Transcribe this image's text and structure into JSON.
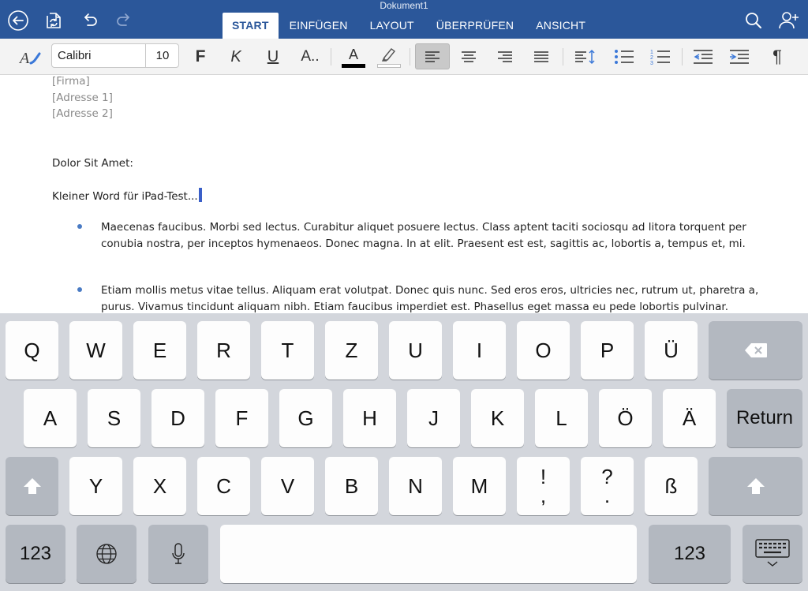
{
  "title_bar": {
    "doc_title": "Dokument1",
    "tabs": [
      {
        "label": "START",
        "active": true
      },
      {
        "label": "EINFÜGEN",
        "active": false
      },
      {
        "label": "LAYOUT",
        "active": false
      },
      {
        "label": "ÜBERPRÜFEN",
        "active": false
      },
      {
        "label": "ANSICHT",
        "active": false
      }
    ],
    "icons": [
      "back-icon",
      "sync-icon",
      "undo-icon",
      "redo-icon",
      "search-icon",
      "add-person-icon"
    ]
  },
  "ribbon": {
    "font_name": "Calibri",
    "font_size": "10",
    "bold_label": "F",
    "italic_label": "K",
    "underline_label": "U",
    "more_label": "A..",
    "font_color_label": "A",
    "paragraph_mark": "¶",
    "font_color": "#000000",
    "highlight_color": "#ffffff"
  },
  "document": {
    "address_lines": [
      "[Firma]",
      "[Adresse 1]",
      "[Adresse 2]"
    ],
    "salutation": "Dolor Sit Amet:",
    "current_line": "Kleiner Word für iPad-Test...",
    "bullets": [
      "Maecenas faucibus. Morbi sed lectus. Curabitur aliquet posuere lectus. Class aptent taciti sociosqu ad litora torquent per conubia nostra, per inceptos hymenaeos. Donec magna. In at elit. Praesent est est, sagittis ac, lobortis a, tempus et, mi.",
      "Etiam mollis metus vitae tellus. Aliquam erat volutpat. Donec quis nunc. Sed eros eros, ultricies nec, rutrum ut, pharetra a, purus. Vivamus tincidunt aliquam nibh. Etiam faucibus imperdiet est. Phasellus eget massa eu pede lobortis pulvinar."
    ]
  },
  "keyboard": {
    "row1": [
      "Q",
      "W",
      "E",
      "R",
      "T",
      "Z",
      "U",
      "I",
      "O",
      "P",
      "Ü"
    ],
    "row2": [
      "A",
      "S",
      "D",
      "F",
      "G",
      "H",
      "J",
      "K",
      "L",
      "Ö",
      "Ä"
    ],
    "row3": [
      "Y",
      "X",
      "C",
      "V",
      "B",
      "N",
      "M"
    ],
    "punct1": [
      "!",
      ","
    ],
    "punct2": [
      "?",
      "."
    ],
    "eszett": "ß",
    "return_label": "Return",
    "numbers_label": "123"
  }
}
